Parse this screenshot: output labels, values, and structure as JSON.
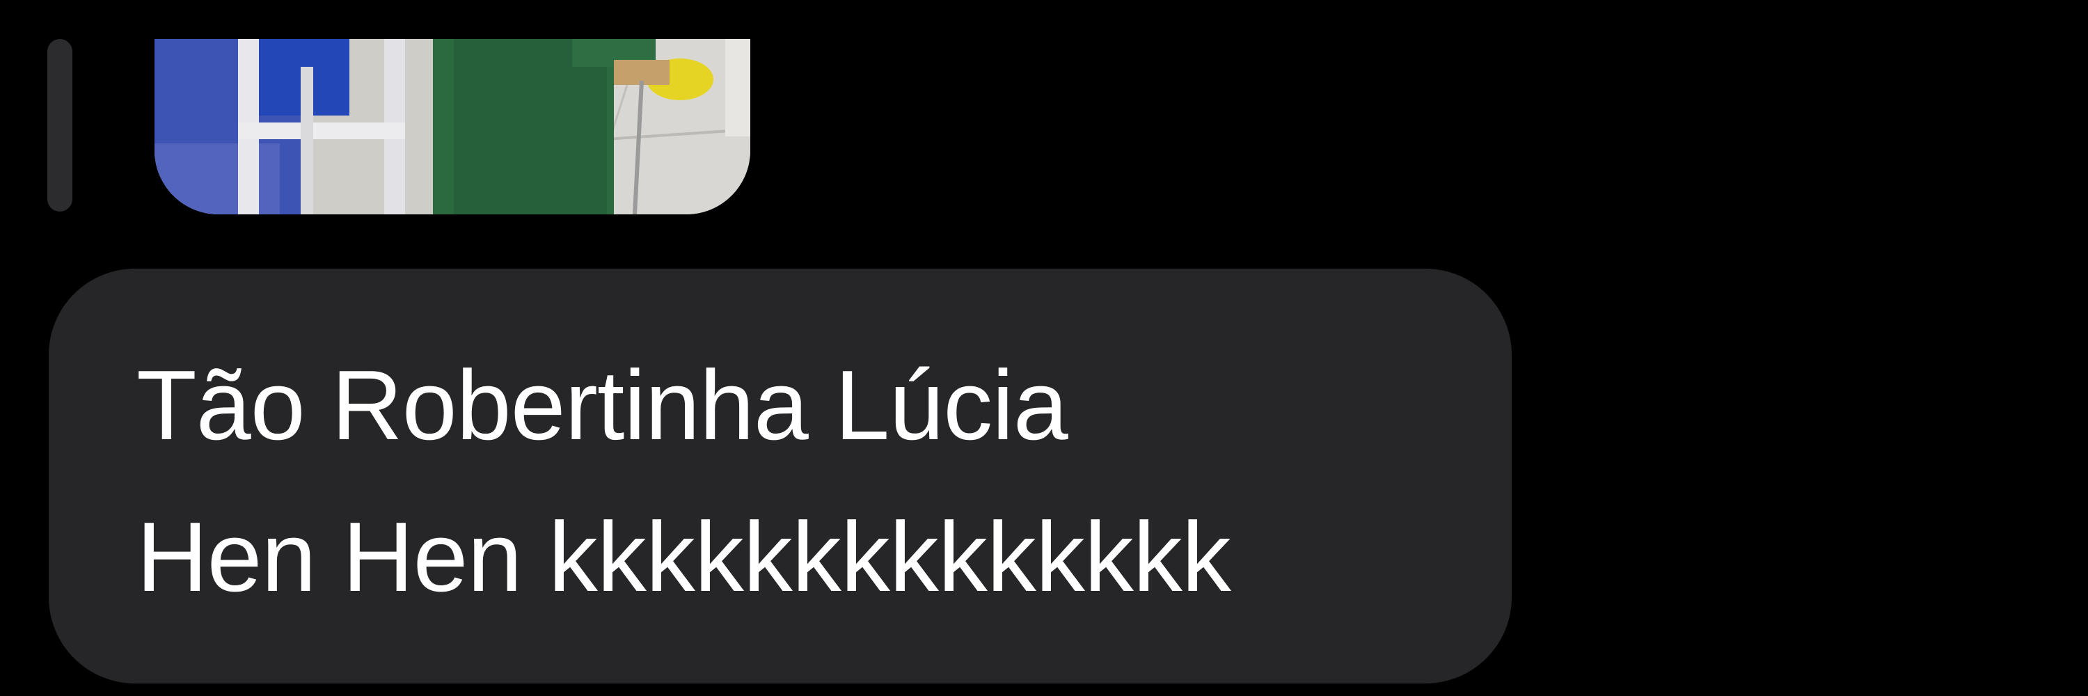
{
  "conversation": {
    "previous_message": {
      "type": "image",
      "icon": "photo-thumbnail"
    },
    "current_message": {
      "lines": [
        "Tão Robertinha Lúcia",
        "Hen Hen kkkkkkkkkkkkkk"
      ]
    }
  },
  "colors": {
    "background": "#000000",
    "bubble": "#262628",
    "text": "#ffffff",
    "reply_bar": "#2c2c2e"
  }
}
